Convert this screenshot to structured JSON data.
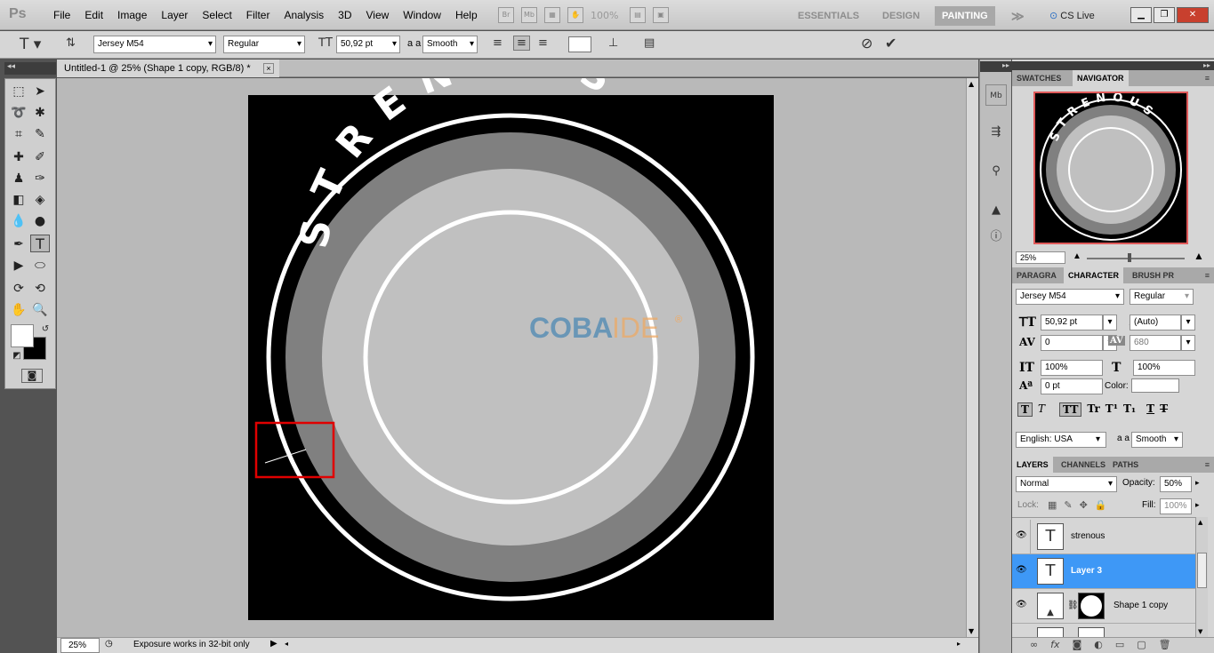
{
  "app": {
    "logo": "Ps"
  },
  "menu": [
    "File",
    "Edit",
    "Image",
    "Layer",
    "Select",
    "Filter",
    "Analysis",
    "3D",
    "View",
    "Window",
    "Help"
  ],
  "menubar_extra": {
    "zoom_level": "100%",
    "bridge": "Br",
    "minibridge": "Mb",
    "cs_live": "CS Live"
  },
  "workspaces": {
    "essentials": "ESSENTIALS",
    "design": "DESIGN",
    "painting": "PAINTING",
    "more": "≫"
  },
  "options": {
    "font_family": "Jersey M54",
    "font_style": "Regular",
    "font_size": "50,92 pt",
    "aa_label": "a a",
    "antialias": "Smooth"
  },
  "document": {
    "tab_title": "Untitled-1 @ 25% (Shape 1 copy, RGB/8) *",
    "close": "×"
  },
  "canvas": {
    "text_arc": "STRENOUS",
    "watermark_main": "COBA",
    "watermark_suffix": "IDE",
    "watermark_reg": "®"
  },
  "status": {
    "zoom": "25%",
    "message": "Exposure works in 32-bit only"
  },
  "navigator": {
    "tab_swatches": "SWATCHES",
    "tab_navigator": "NAVIGATOR",
    "zoom": "25%",
    "preview_text": "STRENOUS"
  },
  "character": {
    "tab_paragraph": "PARAGRA",
    "tab_character": "CHARACTER",
    "tab_brush": "BRUSH PR",
    "font_family": "Jersey M54",
    "font_style": "Regular",
    "size": "50,92 pt",
    "leading": "(Auto)",
    "kerning": "0",
    "tracking": "680",
    "vscale": "100%",
    "hscale": "100%",
    "baseline": "0 pt",
    "color_label": "Color:",
    "language": "English: USA",
    "antialias": "Smooth",
    "aa_label": "a a"
  },
  "layers": {
    "tab_layers": "LAYERS",
    "tab_channels": "CHANNELS",
    "tab_paths": "PATHS",
    "blend_mode": "Normal",
    "opacity_label": "Opacity:",
    "opacity": "50%",
    "lock_label": "Lock:",
    "fill_label": "Fill:",
    "fill": "100%",
    "items": [
      {
        "name": "strenous",
        "type": "T"
      },
      {
        "name": "Layer 3",
        "type": "T"
      },
      {
        "name": "Shape 1 copy",
        "type": "shape"
      }
    ]
  },
  "colors": {
    "accent": "#3e98f6",
    "selection_box": "#e00000"
  }
}
